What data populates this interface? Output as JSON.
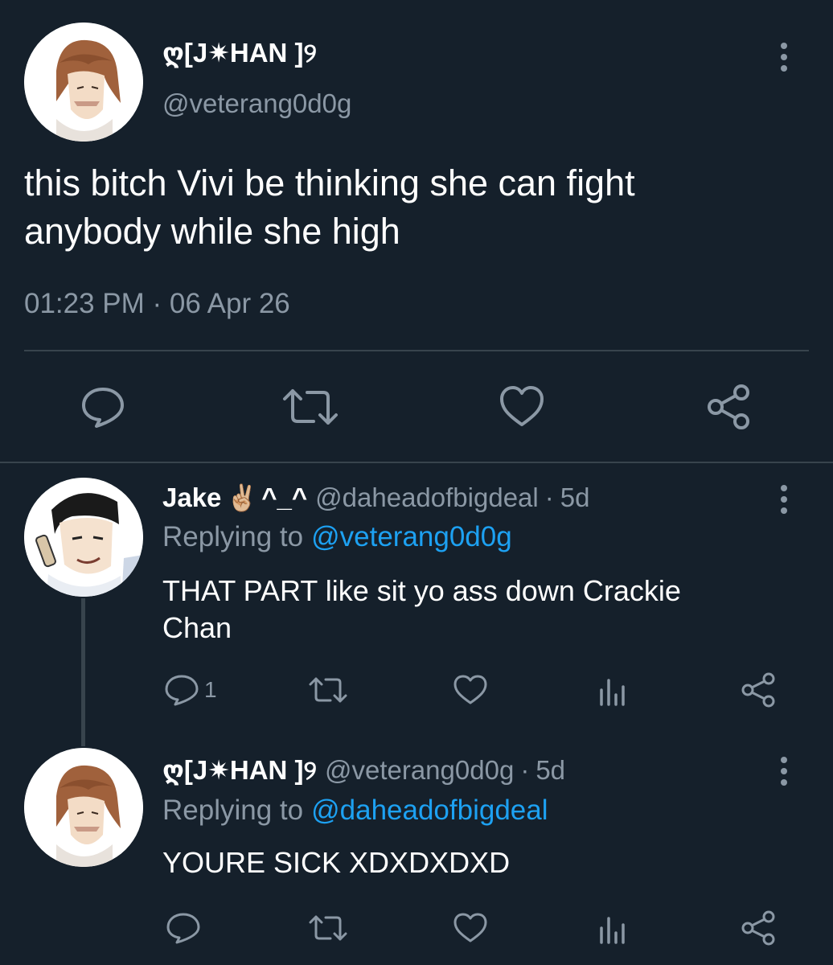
{
  "main_tweet": {
    "display_name": "ღ[J✷HAN ]୨",
    "handle": "@veterang0d0g",
    "text_line1": "this bitch Vivi be thinking she can fight",
    "text_line2": "anybody while she high",
    "timestamp": "01:23 PM · 06 Apr 26",
    "icons": [
      "reply-icon",
      "retweet-icon",
      "like-icon",
      "share-icon"
    ]
  },
  "replies": [
    {
      "display_name": "Jake",
      "emoji": "✌🏼",
      "name_suffix": "^_^",
      "handle": "@daheadofbigdeal",
      "separator": "·",
      "age": "5d",
      "replying_prefix": "Replying to",
      "replying_to": "@veterang0d0g",
      "text_line1": "THAT PART like sit yo ass down Crackie",
      "text_line2": "Chan",
      "reply_count": "1",
      "icons": [
        "reply-icon",
        "retweet-icon",
        "like-icon",
        "analytics-icon",
        "share-icon"
      ]
    },
    {
      "display_name": "ღ[J✷HAN ]୨",
      "handle": "@veterang0d0g",
      "separator": "·",
      "age": "5d",
      "replying_prefix": "Replying to",
      "replying_to": "@daheadofbigdeal",
      "text_line1": "YOURE SICK XDXDXDXD",
      "reply_count": "",
      "icons": [
        "reply-icon",
        "retweet-icon",
        "like-icon",
        "analytics-icon",
        "share-icon"
      ]
    }
  ],
  "colors": {
    "background": "#15202b",
    "text": "#ffffff",
    "muted": "#8b98a5",
    "link": "#1da1f2",
    "divider": "#38444d"
  }
}
